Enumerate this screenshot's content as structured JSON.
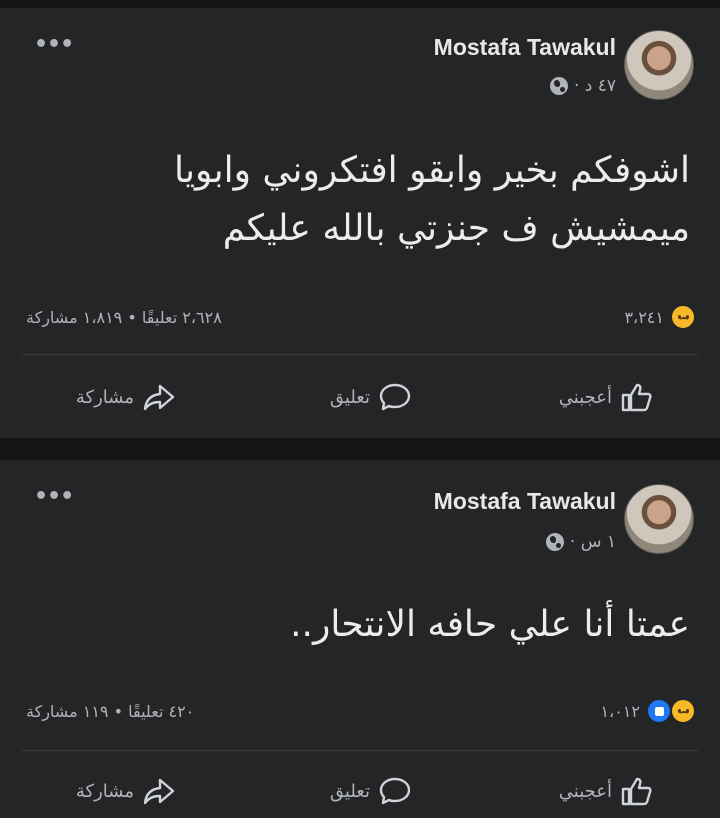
{
  "posts": [
    {
      "author": "Mostafa Tawakul",
      "time": "٤٧ د ·",
      "text_line1": "اشوفكم بخير وابقو افتكروني وابويا",
      "text_line2": "ميمشيش ف جنزتي بالله عليكم",
      "reaction_count": "٣،٢٤١",
      "stats": "٢،٦٢٨ تعليقًا • ١،٨١٩ مشاركة",
      "actions": {
        "like": "أعجبني",
        "comment": "تعليق",
        "share": "مشاركة"
      }
    },
    {
      "author": "Mostafa Tawakul",
      "time": "١ س ·",
      "text_line1": "عمتا أنا علي حافه الانتحار..",
      "reaction_count": "١،٠١٢",
      "stats": "٤٢٠ تعليقًا • ١١٩ مشاركة",
      "actions": {
        "like": "أعجبني",
        "comment": "تعليق",
        "share": "مشاركة"
      }
    }
  ],
  "icons": {
    "more": "more-dots-icon",
    "globe": "globe-icon",
    "sad": "sad-reaction-icon",
    "like_reaction": "like-reaction-icon",
    "like": "thumbs-up-icon",
    "comment": "comment-bubble-icon",
    "share": "share-arrow-icon"
  },
  "colors": {
    "background": "#242526",
    "text": "#e4e6eb",
    "muted": "#b0b3b8"
  }
}
